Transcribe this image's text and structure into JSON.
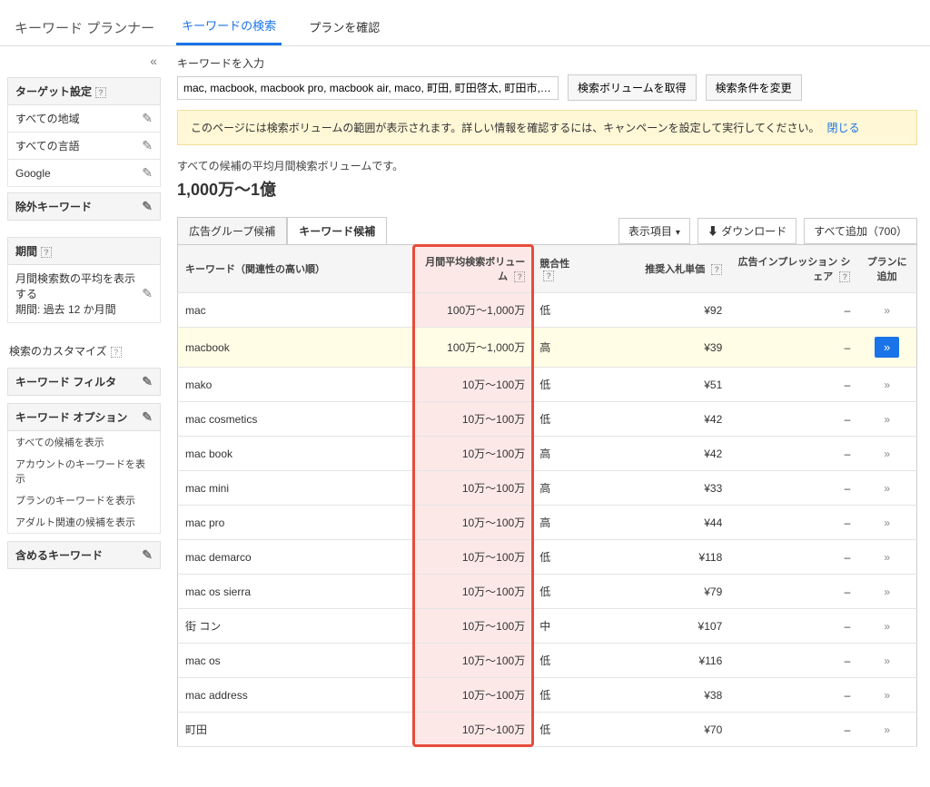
{
  "header": {
    "title": "キーワード プランナー",
    "tab_search": "キーワードの検索",
    "tab_plan": "プランを確認"
  },
  "sidebar": {
    "targeting_heading": "ターゲット設定",
    "targeting_items": [
      "すべての地域",
      "すべての言語",
      "Google"
    ],
    "negative_heading": "除外キーワード",
    "period_heading": "期間",
    "period_text": "月間検索数の平均を表示する\n期間: 過去 12 か月間",
    "customize_heading": "検索のカスタマイズ",
    "filter_heading": "キーワード フィルタ",
    "options_heading": "キーワード オプション",
    "options_items": [
      "すべての候補を表示",
      "アカウントのキーワードを表示",
      "プランのキーワードを表示",
      "アダルト関連の候補を表示"
    ],
    "include_heading": "含めるキーワード"
  },
  "main": {
    "kw_label": "キーワードを入力",
    "kw_value": "mac, macbook, macbook pro, macbook air, maco, 町田, 町田啓太, 町田市, 街コン, 抹茶",
    "btn_get": "検索ボリュームを取得",
    "btn_edit": "検索条件を変更",
    "notice": "このページには検索ボリュームの範囲が表示されます。詳しい情報を確認するには、キャンペーンを設定して実行してください。",
    "notice_close": "閉じる",
    "summary_label": "すべての候補の平均月間検索ボリュームです。",
    "summary_value": "1,000万～1億",
    "tab_adgroup": "広告グループ候補",
    "tab_keyword": "キーワード候補",
    "btn_columns": "表示項目",
    "btn_download": "ダウンロード",
    "btn_addall": "すべて追加（700）"
  },
  "table": {
    "h_keyword": "キーワード（関連性の高い順）",
    "h_volume": "月間平均検索ボリューム",
    "h_competition": "競合性",
    "h_bid": "推奨入札単価",
    "h_impression": "広告インプレッション シェア",
    "h_add": "プランに追加",
    "rows": [
      {
        "kw": "mac",
        "vol": "100万～1,000万",
        "comp": "低",
        "bid": "¥92",
        "imp": "–"
      },
      {
        "kw": "macbook",
        "vol": "100万～1,000万",
        "comp": "高",
        "bid": "¥39",
        "imp": "–",
        "hover": true
      },
      {
        "kw": "mako",
        "vol": "10万～100万",
        "comp": "低",
        "bid": "¥51",
        "imp": "–"
      },
      {
        "kw": "mac cosmetics",
        "vol": "10万～100万",
        "comp": "低",
        "bid": "¥42",
        "imp": "–"
      },
      {
        "kw": "mac book",
        "vol": "10万～100万",
        "comp": "高",
        "bid": "¥42",
        "imp": "–"
      },
      {
        "kw": "mac mini",
        "vol": "10万～100万",
        "comp": "高",
        "bid": "¥33",
        "imp": "–"
      },
      {
        "kw": "mac pro",
        "vol": "10万～100万",
        "comp": "高",
        "bid": "¥44",
        "imp": "–"
      },
      {
        "kw": "mac demarco",
        "vol": "10万～100万",
        "comp": "低",
        "bid": "¥118",
        "imp": "–"
      },
      {
        "kw": "mac os sierra",
        "vol": "10万～100万",
        "comp": "低",
        "bid": "¥79",
        "imp": "–"
      },
      {
        "kw": "街 コン",
        "vol": "10万～100万",
        "comp": "中",
        "bid": "¥107",
        "imp": "–"
      },
      {
        "kw": "mac os",
        "vol": "10万～100万",
        "comp": "低",
        "bid": "¥116",
        "imp": "–"
      },
      {
        "kw": "mac address",
        "vol": "10万～100万",
        "comp": "低",
        "bid": "¥38",
        "imp": "–"
      },
      {
        "kw": "町田",
        "vol": "10万～100万",
        "comp": "低",
        "bid": "¥70",
        "imp": "–"
      }
    ]
  }
}
